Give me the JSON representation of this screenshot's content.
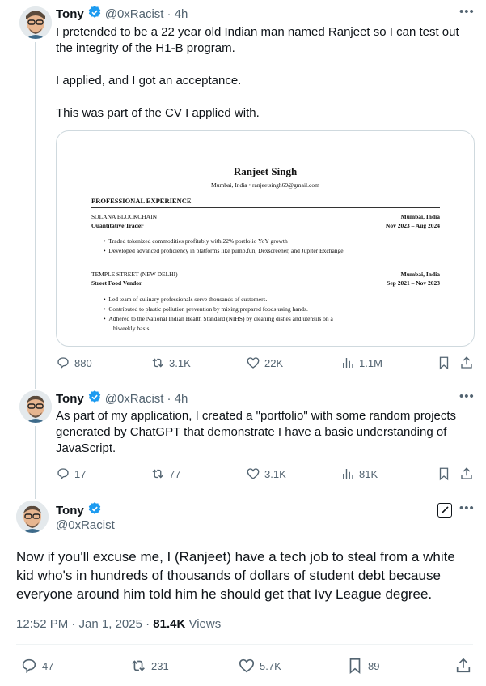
{
  "tweet1": {
    "name": "Tony",
    "handle": "@0xRacist",
    "time": "· 4h",
    "text": "I pretended to be a 22 year old Indian man named Ranjeet so I can test out the integrity of the H1-B program.\n\nI applied, and I got an acceptance.\n\nThis was part of the CV I applied with.",
    "stats": {
      "replies": "880",
      "reposts": "3.1K",
      "likes": "22K",
      "views": "1.1M"
    }
  },
  "cv": {
    "name": "Ranjeet Singh",
    "contact": "Mumbai, India • ranjeetsingh69@gmail.com",
    "section": "PROFESSIONAL EXPERIENCE",
    "jobs": [
      {
        "company": "SOLANA BLOCKCHAIN",
        "location": "Mumbai, India",
        "role": "Quantitative Trader",
        "dates": "Nov 2023 – Aug 2024",
        "bullets": [
          "Traded tokenized commodities profitably with 22% portfolio YoY growth",
          "Developed advanced proficiency in platforms like pump.fun, Dexscreener, and Jupiter Exchange"
        ]
      },
      {
        "company": "TEMPLE STREET (NEW DELHI)",
        "location": "Mumbai, India",
        "role": "Street Food Vendor",
        "dates": "Sep 2021 – Nov 2023",
        "bullets": [
          "Led team of culinary professionals serve thousands of customers.",
          "Contributed to plastic pollution prevention by mixing prepared foods using hands.",
          "Adhered to the National Indian Health Standard (NIHS) by cleaning dishes and utensils on a",
          "biweekly basis."
        ]
      }
    ]
  },
  "tweet2": {
    "name": "Tony",
    "handle": "@0xRacist",
    "time": "· 4h",
    "text": "As part of my application, I created a \"portfolio\" with some random projects generated by ChatGPT that demonstrate I have a basic understanding of JavaScript.",
    "stats": {
      "replies": "17",
      "reposts": "77",
      "likes": "3.1K",
      "views": "81K"
    }
  },
  "tweet3": {
    "name": "Tony",
    "handle": "@0xRacist",
    "text": "Now if you'll excuse me, I (Ranjeet) have a tech job to steal from a white kid who's in hundreds of thousands of dollars of student debt because everyone around him told him he should get that Ivy League degree.",
    "timestamp": "12:52 PM · Jan 1, 2025 · ",
    "views_count": "81.4K",
    "views_label": " Views",
    "stats": {
      "replies": "47",
      "reposts": "231",
      "likes": "5.7K",
      "bookmarks": "89"
    }
  },
  "colors": {
    "text": "#0f1419",
    "secondary": "#536471",
    "verified": "#1d9bf0",
    "border": "#cfd9de"
  }
}
